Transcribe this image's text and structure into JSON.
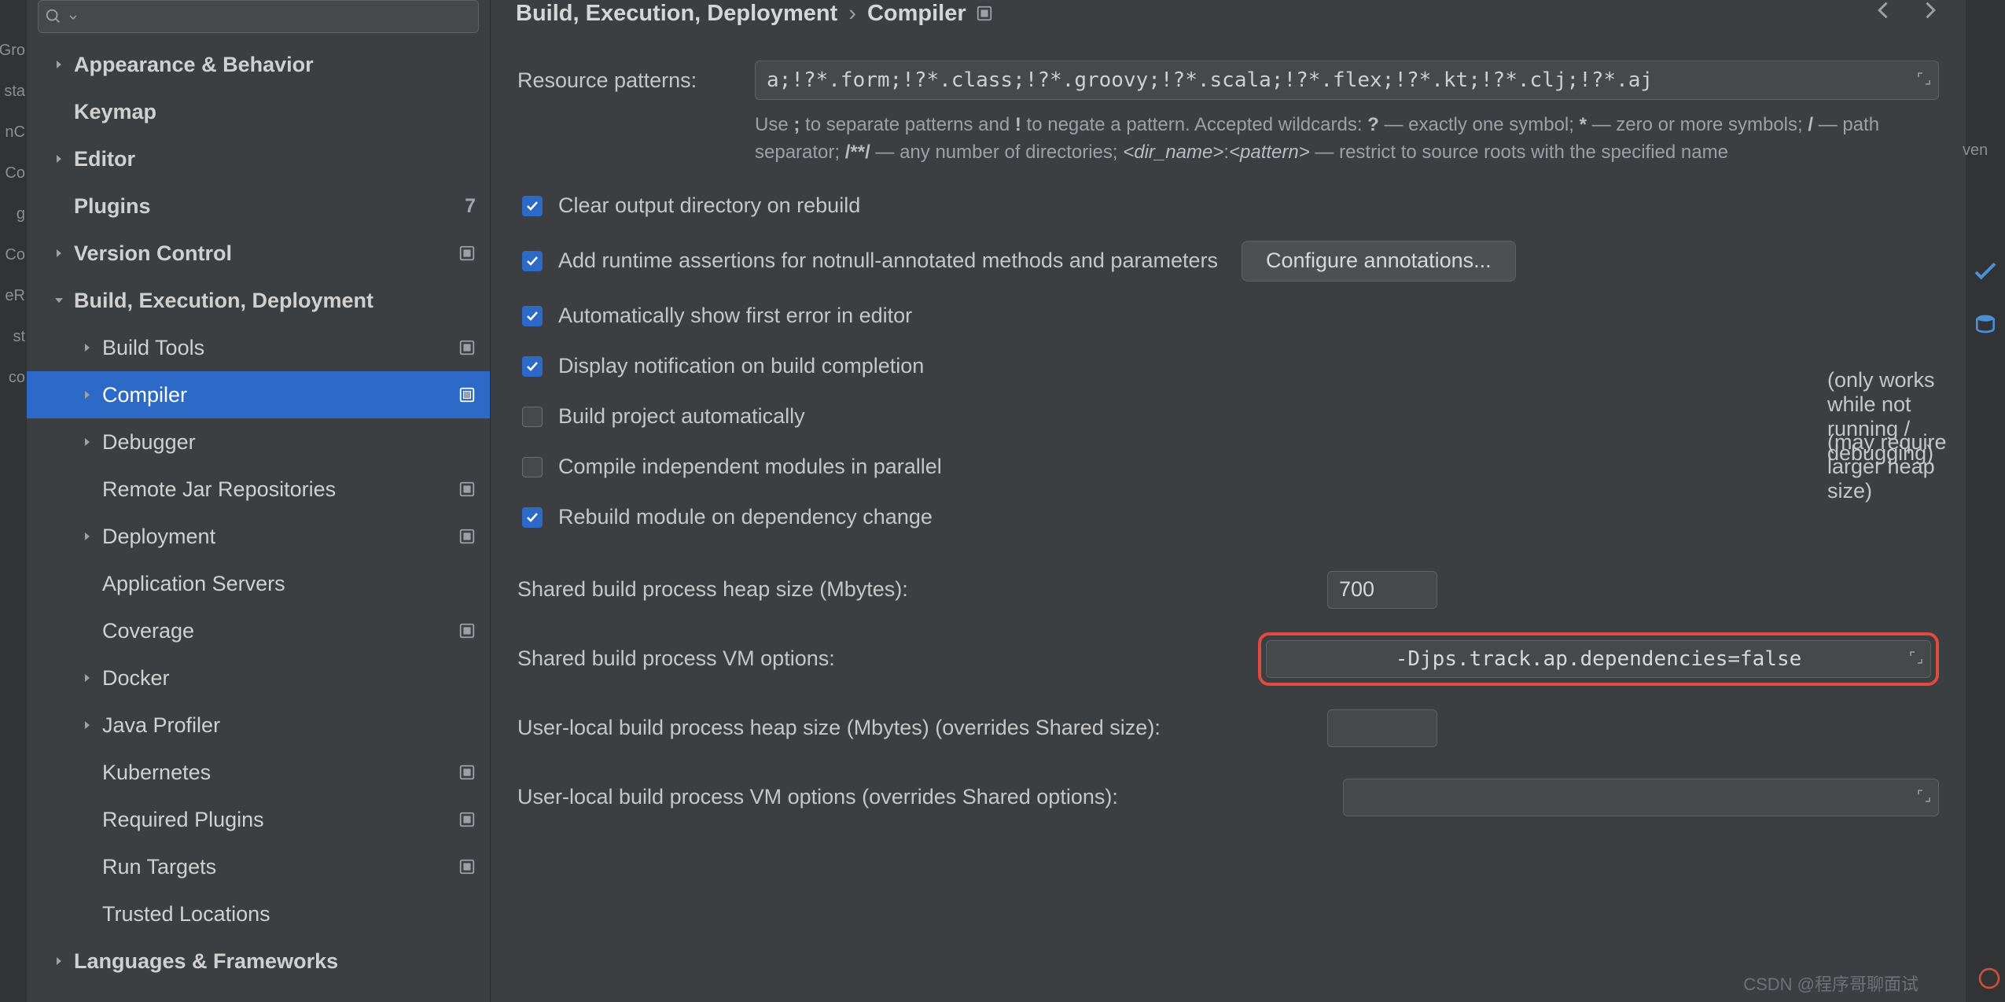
{
  "left_strip": [
    "",
    "Gro",
    "",
    "",
    "",
    "",
    "",
    "",
    "sta",
    "",
    "",
    "",
    "",
    "",
    "nC",
    "Co",
    "g",
    "Co",
    "eR",
    "",
    "",
    "st",
    "",
    "co",
    ""
  ],
  "search": {
    "placeholder": ""
  },
  "sidebar": {
    "items": [
      {
        "label": "Appearance & Behavior",
        "level": 0,
        "bold": true,
        "chevron": "right"
      },
      {
        "label": "Keymap",
        "level": 0,
        "bold": true
      },
      {
        "label": "Editor",
        "level": 0,
        "bold": true,
        "chevron": "right"
      },
      {
        "label": "Plugins",
        "level": 0,
        "bold": true,
        "badge": "7"
      },
      {
        "label": "Version Control",
        "level": 0,
        "bold": true,
        "chevron": "right",
        "sub": true
      },
      {
        "label": "Build, Execution, Deployment",
        "level": 0,
        "bold": true,
        "chevron": "down"
      },
      {
        "label": "Build Tools",
        "level": 1,
        "chevron": "right",
        "sub": true
      },
      {
        "label": "Compiler",
        "level": 1,
        "chevron": "right",
        "sub": true,
        "selected": true
      },
      {
        "label": "Debugger",
        "level": 1,
        "chevron": "right"
      },
      {
        "label": "Remote Jar Repositories",
        "level": 1,
        "sub": true
      },
      {
        "label": "Deployment",
        "level": 1,
        "chevron": "right",
        "sub": true
      },
      {
        "label": "Application Servers",
        "level": 1
      },
      {
        "label": "Coverage",
        "level": 1,
        "sub": true
      },
      {
        "label": "Docker",
        "level": 1,
        "chevron": "right"
      },
      {
        "label": "Java Profiler",
        "level": 1,
        "chevron": "right"
      },
      {
        "label": "Kubernetes",
        "level": 1,
        "sub": true
      },
      {
        "label": "Required Plugins",
        "level": 1,
        "sub": true
      },
      {
        "label": "Run Targets",
        "level": 1,
        "sub": true
      },
      {
        "label": "Trusted Locations",
        "level": 1
      },
      {
        "label": "Languages & Frameworks",
        "level": 0,
        "bold": true,
        "chevron": "right"
      }
    ]
  },
  "breadcrumb": {
    "root": "Build, Execution, Deployment",
    "leaf": "Compiler"
  },
  "form": {
    "resource_patterns_label": "Resource patterns:",
    "resource_patterns_value": "a;!?*.form;!?*.class;!?*.groovy;!?*.scala;!?*.flex;!?*.kt;!?*.clj;!?*.aj",
    "help_html": "Use <strong>;</strong> to separate patterns and <strong>!</strong> to negate a pattern. Accepted wildcards: <strong>?</strong> — exactly one symbol; <strong>*</strong> — zero or more symbols; <strong>/</strong> — path separator; <strong>/**/</strong> — any number of directories; <em>&lt;dir_name&gt;</em>:<em>&lt;pattern&gt;</em> — restrict to source roots with the specified name",
    "cb_clear": "Clear output directory on rebuild",
    "cb_assertions": "Add runtime assertions for notnull-annotated methods and parameters",
    "btn_configure": "Configure annotations...",
    "cb_first_error": "Automatically show first error in editor",
    "cb_notification": "Display notification on build completion",
    "cb_auto_build": "Build project automatically",
    "note_auto_build": "(only works while not running / debugging)",
    "cb_parallel": "Compile independent modules in parallel",
    "note_parallel": "(may require larger heap size)",
    "cb_rebuild_dep": "Rebuild module on dependency change",
    "heap_label": "Shared build process heap size (Mbytes):",
    "heap_value": "700",
    "vm_label": "Shared build process VM options:",
    "vm_value": "-Djps.track.ap.dependencies=false",
    "user_heap_label": "User-local build process heap size (Mbytes) (overrides Shared size):",
    "user_heap_value": "",
    "user_vm_label": "User-local build process VM options (overrides Shared options):",
    "user_vm_value": ""
  },
  "right": {
    "txt": "ven"
  },
  "watermark": "CSDN @程序哥聊面试"
}
